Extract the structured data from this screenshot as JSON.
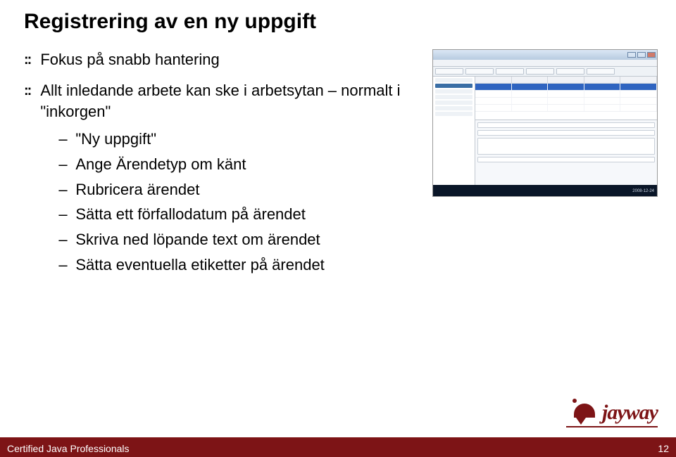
{
  "title": "Registrering av en ny uppgift",
  "bullets": [
    {
      "sym": "::",
      "text": "Fokus på snabb hantering"
    },
    {
      "sym": "::",
      "text": "Allt inledande arbete kan ske i arbetsytan – normalt i \"inkorgen\"",
      "subs": [
        {
          "dash": "–",
          "text": "\"Ny uppgift\""
        },
        {
          "dash": "–",
          "text": "Ange Ärendetyp om känt"
        },
        {
          "dash": "–",
          "text": "Rubricera ärendet"
        },
        {
          "dash": "–",
          "text": "Sätta ett förfallodatum på ärendet"
        },
        {
          "dash": "–",
          "text": "Skriva ned löpande text om ärendet"
        },
        {
          "dash": "–",
          "text": "Sätta eventuella etiketter på ärendet"
        }
      ]
    }
  ],
  "footer": {
    "text": "Certified Java Professionals",
    "page_number": "12"
  },
  "brand": {
    "name": "jayway"
  },
  "app_thumb": {
    "status_time": "2008-12-24"
  }
}
